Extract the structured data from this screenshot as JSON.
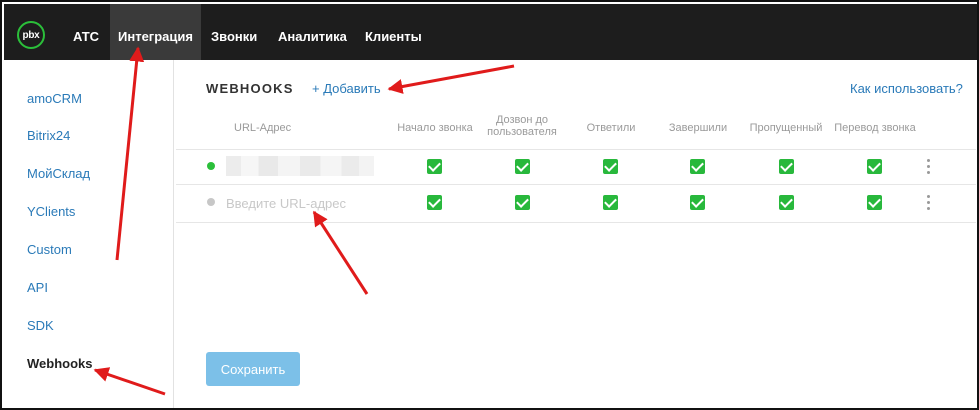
{
  "app": {
    "logo_text": "pbx",
    "nav": [
      {
        "label": "АТС",
        "active": false
      },
      {
        "label": "Интеграция",
        "active": true
      },
      {
        "label": "Звонки",
        "active": false
      },
      {
        "label": "Аналитика",
        "active": false
      },
      {
        "label": "Клиенты",
        "active": false
      }
    ]
  },
  "sidebar": {
    "items": [
      {
        "label": "amoCRM"
      },
      {
        "label": "Bitrix24"
      },
      {
        "label": "МойСклад"
      },
      {
        "label": "YClients"
      },
      {
        "label": "Custom"
      },
      {
        "label": "API"
      },
      {
        "label": "SDK"
      },
      {
        "label": "Webhooks",
        "current": true
      }
    ]
  },
  "main": {
    "title": "WEBHOOKS",
    "add_label": "+ Добавить",
    "help_label": "Как использовать?",
    "columns": [
      "URL-Адрес",
      "Начало звонка",
      "Дозвон до пользователя",
      "Ответили",
      "Завершили",
      "Пропущенный",
      "Перевод звонка"
    ],
    "rows": [
      {
        "status": "active",
        "url": "",
        "events": [
          true,
          true,
          true,
          true,
          true,
          true
        ]
      },
      {
        "status": "inactive",
        "url_placeholder": "Введите URL-адрес",
        "events": [
          true,
          true,
          true,
          true,
          true,
          true
        ]
      }
    ],
    "save_label": "Сохранить"
  },
  "colors": {
    "topbar": "#1d1d1d",
    "accent_link": "#2a7ab8",
    "checkbox": "#28b83c",
    "status_active": "#2bbf3a",
    "save_button": "#7cc0e8",
    "annotation_arrow": "#e01b1b"
  }
}
